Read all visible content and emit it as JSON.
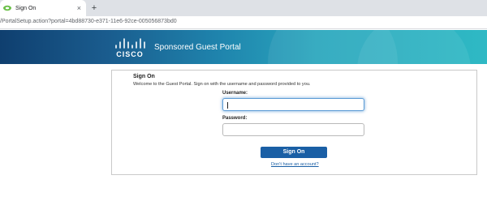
{
  "browser": {
    "tab": {
      "title": "Sign On",
      "close_glyph": "×"
    },
    "new_tab_glyph": "+",
    "url": "/PortalSetup.action?portal=4bd88730-e371-11e6-92ce-005056873bd0"
  },
  "banner": {
    "logo_text": "CISCO",
    "portal_title": "Sponsored Guest Portal",
    "colors": {
      "start": "#0f3f6f",
      "end": "#2fb9c4"
    }
  },
  "signon": {
    "title": "Sign On",
    "welcome": "Welcome to the Guest Portal. Sign on with the username and password provided to you.",
    "username_label": "Username:",
    "username_value": "",
    "password_label": "Password:",
    "password_value": "",
    "button_label": "Sign On",
    "account_link": "Don't have an account?",
    "accent_color": "#1a5fa5"
  }
}
